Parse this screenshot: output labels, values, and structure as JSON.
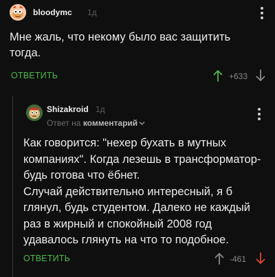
{
  "comment1": {
    "author": "bloodymc",
    "time": "1д",
    "text_lines": [
      "Мне жаль, что некому было вас защитить",
      "тогда."
    ],
    "reply_label": "ОТВЕТИТЬ",
    "rating": "+633",
    "avatar_icon": "cartoon-avatar-icon",
    "colors": {
      "accent": "#4cbb4c",
      "vote_up": "#4cbb4c",
      "vote_down": "#8a8a8a"
    }
  },
  "comment2": {
    "author": "Shizakroid",
    "time": "1д",
    "reply_to_prefix": "Ответ на",
    "reply_to_target": "комментарий",
    "text_lines": [
      "Как говорится: \"нехер бухать в мутных",
      "компаниях\". Когда лезешь в трансформатор-",
      "будь готова что ёбнет.",
      "Случай действительно интересный, я б",
      "глянул, будь студентом. Далеко не каждый",
      "раз в жирный и спокойный 2008 год",
      "удавалось глянуть на что то подобное."
    ],
    "reply_label": "ОТВЕТИТЬ",
    "rating": "-461",
    "avatar_icon": "cartoon-avatar-icon",
    "colors": {
      "vote_up": "#8a8a8a",
      "vote_down": "#e0482d"
    }
  }
}
